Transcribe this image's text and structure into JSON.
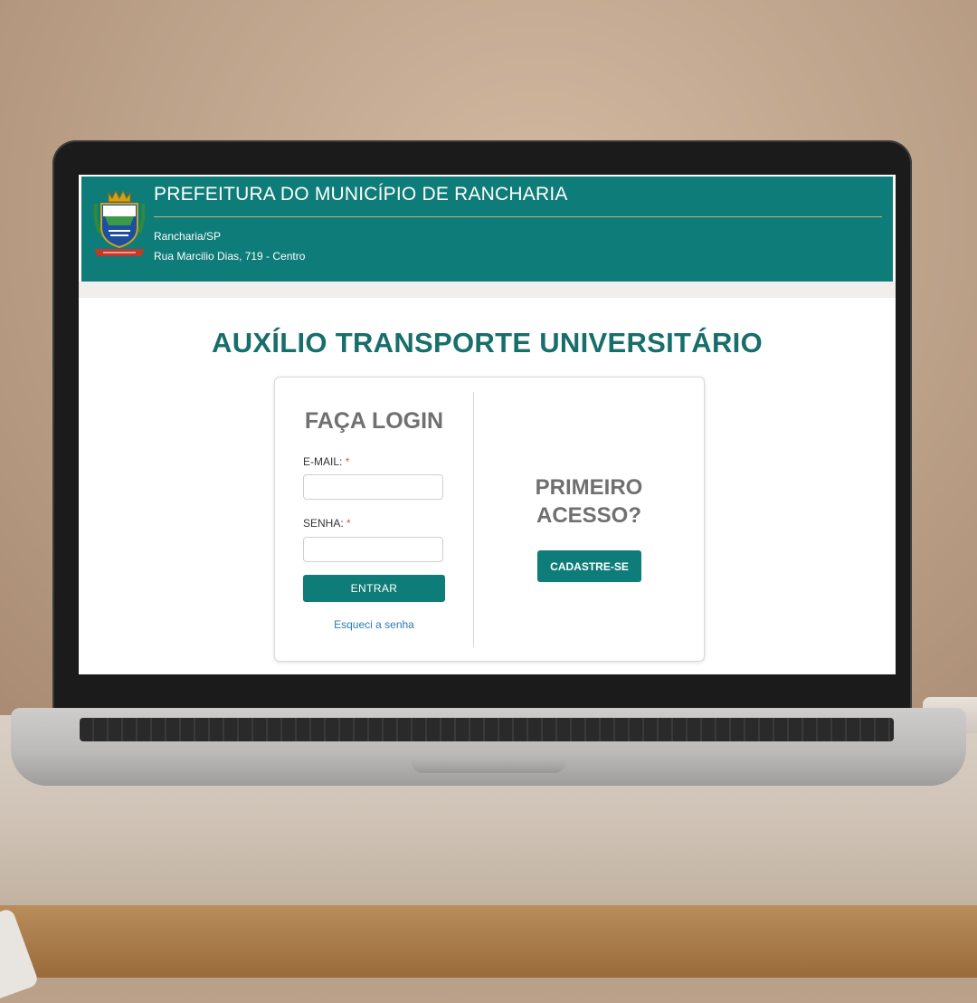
{
  "header": {
    "title": "PREFEITURA DO MUNICÍPIO DE RANCHARIA",
    "city": "Rancharia/SP",
    "address": "Rua Marcilio Dias, 719 - Centro",
    "crest_icon": "municipal-coat-of-arms",
    "color": "#0e7c78"
  },
  "page": {
    "title": "AUXÍLIO TRANSPORTE UNIVERSITÁRIO"
  },
  "login": {
    "title": "FAÇA LOGIN",
    "email_label": "E-MAIL:",
    "password_label": "SENHA:",
    "required_mark": "*",
    "email_value": "",
    "password_value": "",
    "submit_label": "ENTRAR",
    "forgot_label": "Esqueci a senha"
  },
  "signup": {
    "title_line1": "PRIMEIRO",
    "title_line2": "ACESSO?",
    "button_label": "CADASTRE-SE"
  },
  "colors": {
    "accent": "#0e7c78",
    "title": "#176e6b",
    "link": "#2a7ab8",
    "required": "#d9534f"
  }
}
